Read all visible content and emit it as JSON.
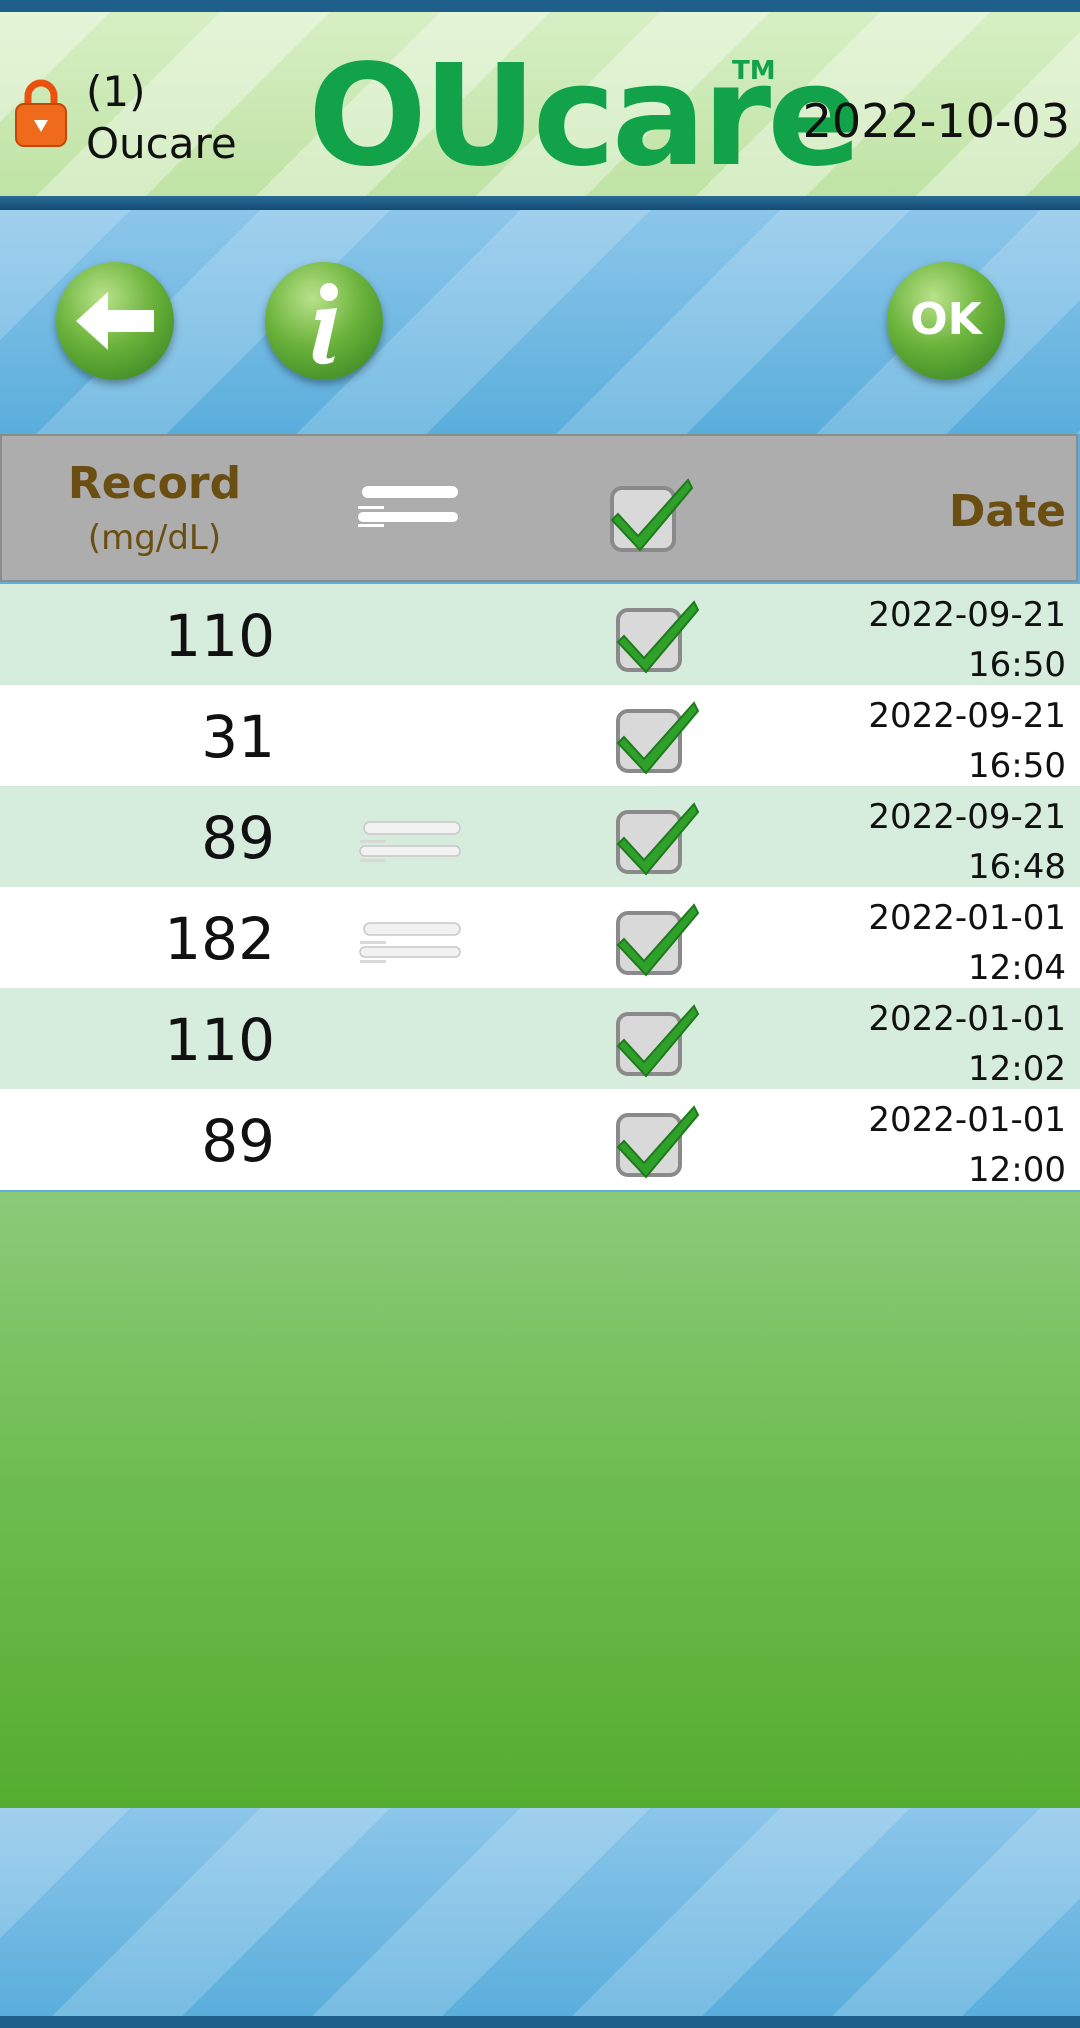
{
  "header": {
    "user_index": "(1)",
    "user_name": "Oucare",
    "logo_text": "OUcare",
    "logo_tm": "TM",
    "date": "2022-10-03"
  },
  "toolbar": {
    "back_icon": "arrow-left-icon",
    "info_icon": "info-icon",
    "ok_label": "OK"
  },
  "table": {
    "columns": {
      "record_label": "Record",
      "record_unit": "(mg/dL)",
      "meal_icon": "fork-knife-icon",
      "check_icon": "checkbox-checked-icon",
      "date_label": "Date"
    },
    "rows": [
      {
        "value": "110",
        "meal": false,
        "checked": true,
        "date": "2022-09-21",
        "time": "16:50"
      },
      {
        "value": "31",
        "meal": false,
        "checked": true,
        "date": "2022-09-21",
        "time": "16:50"
      },
      {
        "value": "89",
        "meal": true,
        "checked": true,
        "date": "2022-09-21",
        "time": "16:48"
      },
      {
        "value": "182",
        "meal": true,
        "checked": true,
        "date": "2022-01-01",
        "time": "12:04"
      },
      {
        "value": "110",
        "meal": false,
        "checked": true,
        "date": "2022-01-01",
        "time": "12:02"
      },
      {
        "value": "89",
        "meal": false,
        "checked": true,
        "date": "2022-01-01",
        "time": "12:00"
      }
    ]
  },
  "colors": {
    "brand_green": "#11a24a",
    "header_label_brown": "#6b4e12",
    "row_alt": "#d6ecdc",
    "frame_blue": "#1e5f8b"
  }
}
